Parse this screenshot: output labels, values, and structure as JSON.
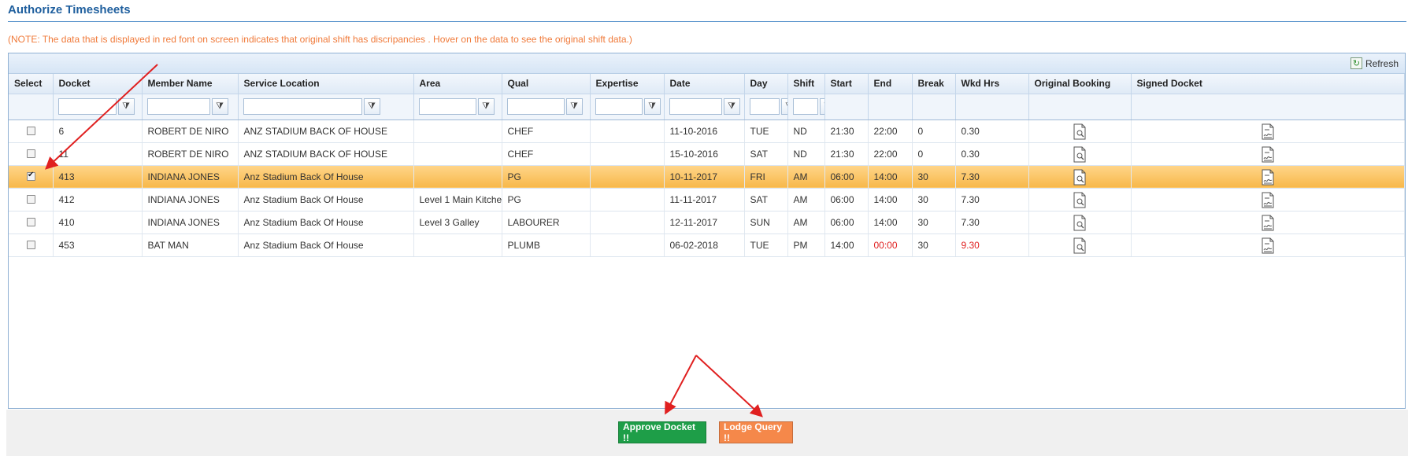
{
  "page": {
    "title": "Authorize Timesheets",
    "note": "(NOTE: The data that is displayed in red font on screen indicates that original shift has discripancies . Hover on the data to see the original shift data.)"
  },
  "toolbar": {
    "refresh_label": "Refresh"
  },
  "columns": [
    "Select",
    "Docket",
    "Member Name",
    "Service Location",
    "Area",
    "Qual",
    "Expertise",
    "Date",
    "Day",
    "Shift",
    "Start",
    "End",
    "Break",
    "Wkd Hrs",
    "Original Booking",
    "Signed Docket"
  ],
  "rows": [
    {
      "selected": false,
      "docket": "6",
      "member": "ROBERT DE NIRO",
      "location": "ANZ STADIUM BACK OF HOUSE",
      "area": "",
      "qual": "CHEF",
      "expertise": "",
      "date": "11-10-2016",
      "day": "TUE",
      "shift": "ND",
      "start": "21:30",
      "end": "22:00",
      "break": "0",
      "wkd": "0.30"
    },
    {
      "selected": false,
      "docket": "11",
      "member": "ROBERT DE NIRO",
      "location": "ANZ STADIUM BACK OF HOUSE",
      "area": "",
      "qual": "CHEF",
      "expertise": "",
      "date": "15-10-2016",
      "day": "SAT",
      "shift": "ND",
      "start": "21:30",
      "end": "22:00",
      "break": "0",
      "wkd": "0.30"
    },
    {
      "selected": true,
      "docket": "413",
      "member": "INDIANA JONES",
      "location": "Anz Stadium Back Of House",
      "area": "",
      "qual": "PG",
      "expertise": "",
      "date": "10-11-2017",
      "day": "FRI",
      "shift": "AM",
      "start": "06:00",
      "end": "14:00",
      "break": "30",
      "wkd": "7.30"
    },
    {
      "selected": false,
      "docket": "412",
      "member": "INDIANA JONES",
      "location": "Anz Stadium Back Of House",
      "area": "Level 1 Main Kitchen",
      "qual": "PG",
      "expertise": "",
      "date": "11-11-2017",
      "day": "SAT",
      "shift": "AM",
      "start": "06:00",
      "end": "14:00",
      "break": "30",
      "wkd": "7.30"
    },
    {
      "selected": false,
      "docket": "410",
      "member": "INDIANA JONES",
      "location": "Anz Stadium Back Of House",
      "area": "Level 3 Galley",
      "qual": "LABOURER",
      "expertise": "",
      "date": "12-11-2017",
      "day": "SUN",
      "shift": "AM",
      "start": "06:00",
      "end": "14:00",
      "break": "30",
      "wkd": "7.30"
    },
    {
      "selected": false,
      "docket": "453",
      "member": "BAT MAN",
      "location": "Anz Stadium Back Of House",
      "area": "",
      "qual": "PLUMB",
      "expertise": "",
      "date": "06-02-2018",
      "day": "TUE",
      "shift": "PM",
      "start": "14:00",
      "end": "00:00",
      "break": "30",
      "wkd": "9.30",
      "discrepancy": [
        "end",
        "wkd"
      ]
    }
  ],
  "footer": {
    "approve_label": "Approve Docket !!",
    "lodge_label": "Lodge Query !!"
  },
  "colors": {
    "title": "#1f5f9e",
    "note": "#f07a3a",
    "approve": "#1e9e48",
    "lodge": "#f5884a",
    "selected_row": "#f7b84a",
    "discrepancy": "#e02020",
    "annotation_arrow": "#e02020"
  },
  "icons": {
    "refresh": "refresh-icon",
    "filter": "filter-icon",
    "original_booking": "document-search-icon",
    "signed_docket": "signed-document-icon"
  }
}
